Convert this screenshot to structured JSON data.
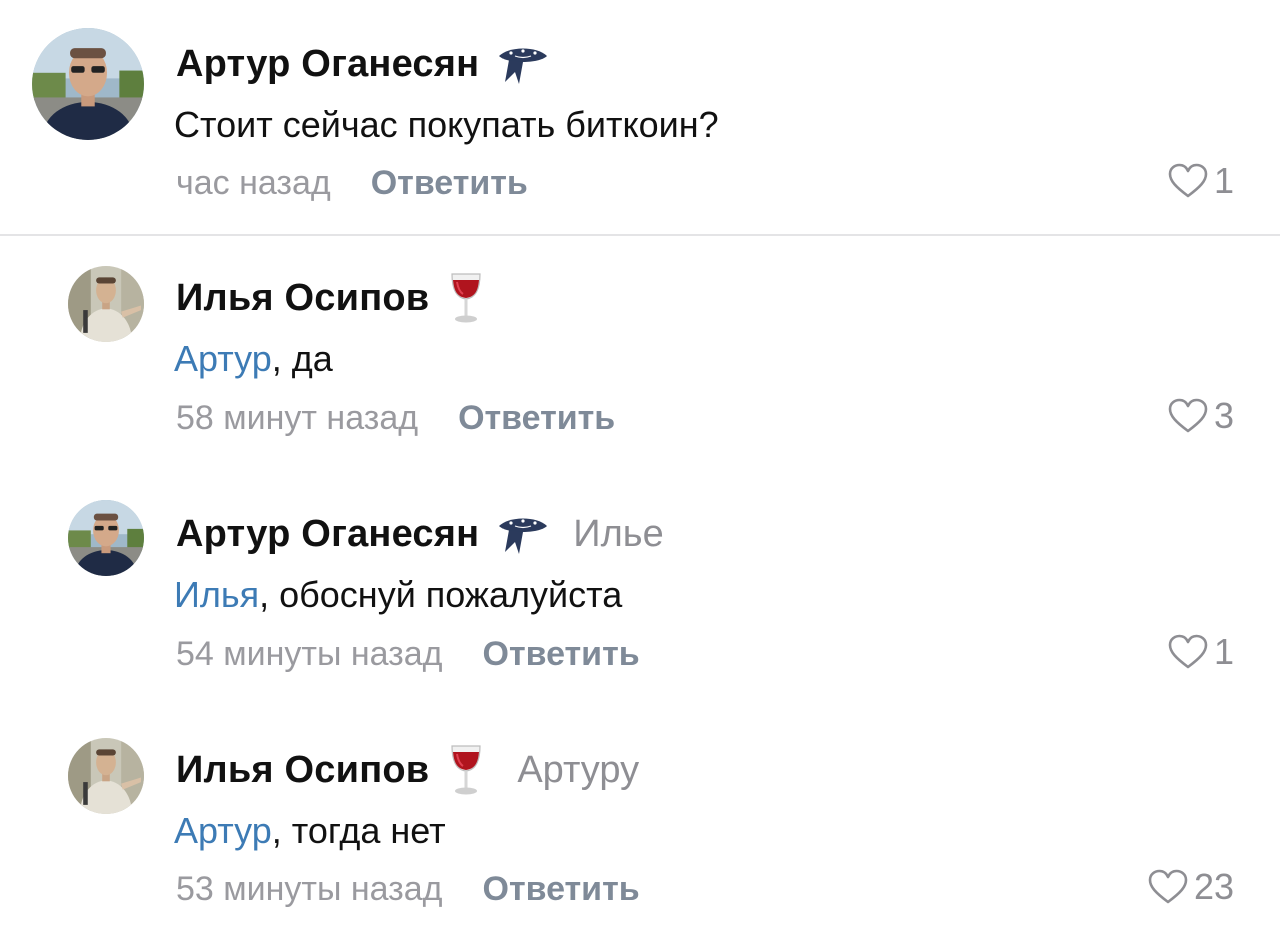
{
  "comments": [
    {
      "author": "Артур Оганесян",
      "badge": "bandana-icon",
      "reply_to": "",
      "mention": "",
      "text": "Стоит сейчас покупать биткоин?",
      "time": "час назад",
      "reply_label": "Ответить",
      "likes": "1"
    },
    {
      "author": "Илья Осипов",
      "badge": "wine-glass-icon",
      "reply_to": "",
      "mention": "Артур",
      "text": ", да",
      "time": "58 минут назад",
      "reply_label": "Ответить",
      "likes": "3"
    },
    {
      "author": "Артур Оганесян",
      "badge": "bandana-icon",
      "reply_to": "Илье",
      "mention": "Илья",
      "text": ", обоснуй пожалуйста",
      "time": "54 минуты назад",
      "reply_label": "Ответить",
      "likes": "1"
    },
    {
      "author": "Илья Осипов",
      "badge": "wine-glass-icon",
      "reply_to": "Артуру",
      "mention": "Артур",
      "text": ", тогда нет",
      "time": "53 минуты назад",
      "reply_label": "Ответить",
      "likes": "23"
    }
  ],
  "colors": {
    "mention": "#3d7bb5",
    "meta": "#9a9a9f",
    "reply_button": "#7f8a98",
    "divider": "#e4e4e6"
  }
}
